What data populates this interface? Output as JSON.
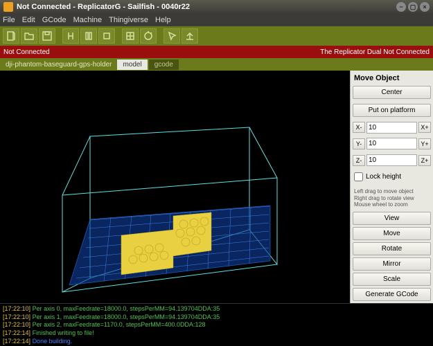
{
  "window": {
    "title": "Not Connected - ReplicatorG - Sailfish - 0040r22"
  },
  "menu": {
    "items": [
      "File",
      "Edit",
      "GCode",
      "Machine",
      "Thingiverse",
      "Help"
    ]
  },
  "status": {
    "left": "Not Connected",
    "right": "The Replicator Dual Not Connected"
  },
  "tabs": {
    "file": "dji-phantom-baseguard-gps-holder",
    "model": "model",
    "gcode": "gcode"
  },
  "panel": {
    "title": "Move Object",
    "center": "Center",
    "platform": "Put on platform",
    "x_minus": "X-",
    "x_plus": "X+",
    "x_val": "10",
    "y_minus": "Y-",
    "y_plus": "Y+",
    "y_val": "10",
    "z_minus": "Z-",
    "z_plus": "Z+",
    "z_val": "10",
    "lock": "Lock height",
    "hint1": "Left drag to move object",
    "hint2": "Right drag to rotate view",
    "hint3": "Mouse wheel to zoom",
    "view": "View",
    "move": "Move",
    "rotate": "Rotate",
    "mirror": "Mirror",
    "scale": "Scale",
    "generate": "Generate GCode"
  },
  "console": {
    "l1_ts": "[17:22:10]",
    "l1_msg": "Per axis 0, maxFeedrate=18000.0, stepsPerMM=94.139704DDA:35",
    "l2_ts": "[17:22:10]",
    "l2_msg": "Per axis 1, maxFeedrate=18000.0, stepsPerMM=94.139704DDA:35",
    "l3_ts": "[17:22:10]",
    "l3_msg": "Per axis 2, maxFeedrate=1170.0, stepsPerMM=400.0DDA:128",
    "l4_ts": "[17:22:14]",
    "l4_msg": "Finished writing to file!",
    "l5_ts": "[17:22:14]",
    "l5_msg": "Done building."
  }
}
